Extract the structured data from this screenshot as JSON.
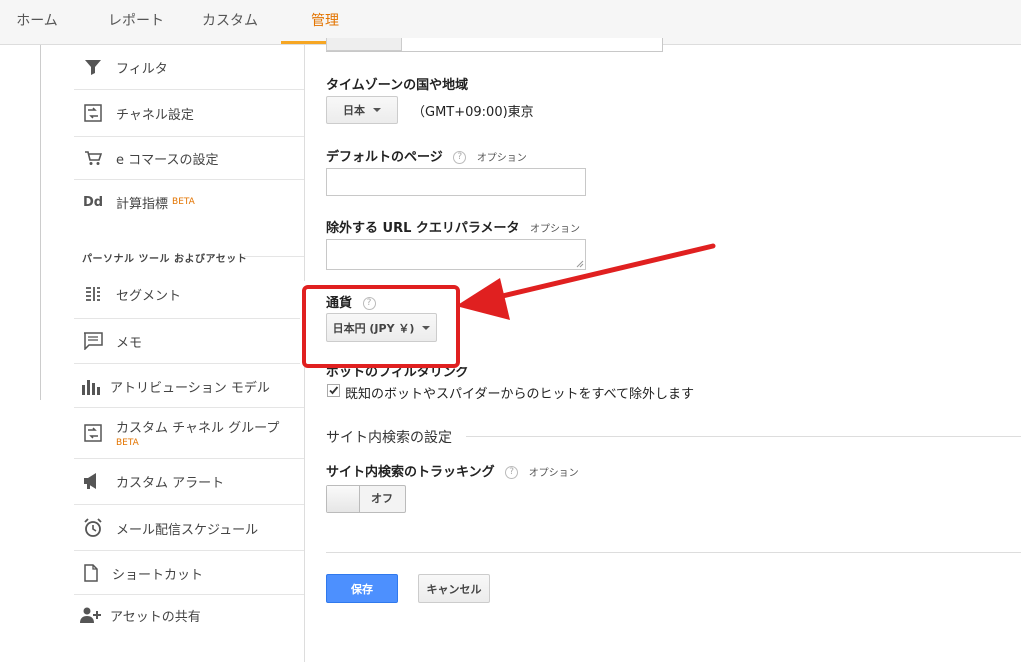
{
  "nav": {
    "tabs": [
      {
        "label": "ホーム"
      },
      {
        "label": "レポート"
      },
      {
        "label": "カスタム"
      },
      {
        "label": "管理"
      }
    ]
  },
  "sidebar": {
    "items": [
      {
        "label": "フィルタ",
        "icon": "filter-icon"
      },
      {
        "label": "チャネル設定",
        "icon": "channel-icon"
      },
      {
        "label": "e コマースの設定",
        "icon": "cart-icon"
      },
      {
        "label": "計算指標",
        "icon": "dd-icon",
        "badge": "BETA"
      }
    ],
    "section_title": "パーソナル ツール およびアセット",
    "personal_items": [
      {
        "label": "セグメント",
        "icon": "segment-icon"
      },
      {
        "label": "メモ",
        "icon": "memo-icon"
      },
      {
        "label": "アトリビューション モデル",
        "icon": "bar-chart-icon"
      },
      {
        "label": "カスタム チャネル グループ",
        "icon": "channel-icon",
        "badge": "BETA"
      },
      {
        "label": "カスタム アラート",
        "icon": "megaphone-icon"
      },
      {
        "label": "メール配信スケジュール",
        "icon": "alarm-clock-icon"
      },
      {
        "label": "ショートカット",
        "icon": "document-icon"
      },
      {
        "label": "アセットの共有",
        "icon": "add-user-icon"
      }
    ]
  },
  "form": {
    "timezone": {
      "label": "タイムゾーンの国や地域",
      "country": "日本",
      "value": "（GMT+09:00)東京"
    },
    "default_page": {
      "label": "デフォルトのページ",
      "help": "?",
      "option": "オプション",
      "value": ""
    },
    "exclude_params": {
      "label": "除外する URL クエリパラメータ",
      "option": "オプション",
      "value": ""
    },
    "currency": {
      "label": "通貨",
      "help": "?",
      "value": "日本円 (JPY ￥)"
    },
    "bot_filter": {
      "label": "ボットのフィルタリング",
      "checkbox_label": "既知のボットやスパイダーからのヒットをすべて除外します",
      "checked": true
    },
    "site_search": {
      "section_title": "サイト内検索の設定",
      "label": "サイト内検索のトラッキング",
      "help": "?",
      "option": "オプション",
      "toggle": "オフ"
    },
    "save": "保存",
    "cancel": "キャンセル"
  },
  "colors": {
    "accent": "#e37400",
    "save_button": "#4d90fe",
    "highlight": "#e02020"
  }
}
